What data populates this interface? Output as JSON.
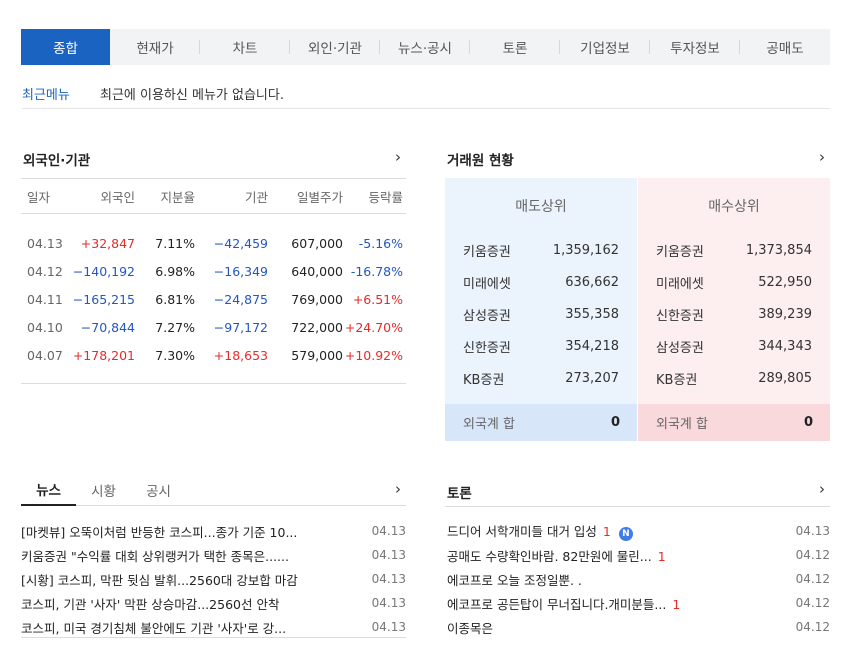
{
  "tabs": [
    "종합",
    "현재가",
    "차트",
    "외인·기관",
    "뉴스·공시",
    "토론",
    "기업정보",
    "투자정보",
    "공매도"
  ],
  "recent": {
    "label": "최근메뉴",
    "message": "최근에 이용하신 메뉴가 없습니다."
  },
  "foreign": {
    "title": "외국인·기관",
    "headers": [
      "일자",
      "외국인",
      "지분율",
      "기관",
      "일별주가",
      "등락률"
    ],
    "rows": [
      {
        "date": "04.13",
        "foreign": "+32,847",
        "share": "7.11%",
        "inst": "−42,459",
        "close": "607,000",
        "rate": "-5.16%"
      },
      {
        "date": "04.12",
        "foreign": "−140,192",
        "share": "6.98%",
        "inst": "−16,349",
        "close": "640,000",
        "rate": "-16.78%"
      },
      {
        "date": "04.11",
        "foreign": "−165,215",
        "share": "6.81%",
        "inst": "−24,875",
        "close": "769,000",
        "rate": "+6.51%"
      },
      {
        "date": "04.10",
        "foreign": "−70,844",
        "share": "7.27%",
        "inst": "−97,172",
        "close": "722,000",
        "rate": "+24.70%"
      },
      {
        "date": "04.07",
        "foreign": "+178,201",
        "share": "7.30%",
        "inst": "+18,653",
        "close": "579,000",
        "rate": "+10.92%"
      }
    ]
  },
  "broker": {
    "title": "거래원 현황",
    "sell": {
      "header": "매도상위",
      "items": [
        {
          "name": "키움증권",
          "value": "1,359,162"
        },
        {
          "name": "미래에셋",
          "value": "636,662"
        },
        {
          "name": "삼성증권",
          "value": "355,358"
        },
        {
          "name": "신한증권",
          "value": "354,218"
        },
        {
          "name": "KB증권",
          "value": "273,207"
        }
      ],
      "sum_label": "외국계 합",
      "sum_value": "0"
    },
    "buy": {
      "header": "매수상위",
      "items": [
        {
          "name": "키움증권",
          "value": "1,373,854"
        },
        {
          "name": "미래에셋",
          "value": "522,950"
        },
        {
          "name": "신한증권",
          "value": "389,239"
        },
        {
          "name": "삼성증권",
          "value": "344,343"
        },
        {
          "name": "KB증권",
          "value": "289,805"
        }
      ],
      "sum_label": "외국계 합",
      "sum_value": "0"
    }
  },
  "news": {
    "tabs": [
      "뉴스",
      "시황",
      "공시"
    ],
    "items": [
      {
        "title": "[마켓뷰] 오뚝이처럼 반등한 코스피...종가 기준 10...",
        "date": "04.13"
      },
      {
        "title": "키움증권 \"수익률 대회 상위랭커가 택한 종목은......",
        "date": "04.13"
      },
      {
        "title": "[시황] 코스피, 막판 뒷심 발휘...2560대 강보합 마감",
        "date": "04.13"
      },
      {
        "title": "코스피, 기관 '사자' 막판 상승마감...2560선 안착",
        "date": "04.13"
      },
      {
        "title": "코스피, 미국 경기침체 불안에도 기관 '사자'로 강...",
        "date": "04.13"
      }
    ]
  },
  "discussion": {
    "title": "토론",
    "items": [
      {
        "title": "드디어 서학개미들 대거 입성",
        "count": "1",
        "badge": "N",
        "date": "04.13"
      },
      {
        "title": "공매도 수량확인바람. 82만원에 물린...",
        "count": "1",
        "badge": "",
        "date": "04.12"
      },
      {
        "title": "에코프로 오늘 조정일뿐. .",
        "count": "",
        "badge": "",
        "date": "04.12"
      },
      {
        "title": "에코프로 공든탑이 무너집니다.개미분들...",
        "count": "1",
        "badge": "",
        "date": "04.12"
      },
      {
        "title": "이종목은",
        "count": "",
        "badge": "",
        "date": "04.12"
      }
    ]
  },
  "icons": {
    "more": "chevron-right-icon",
    "new_badge": "new-badge-icon"
  },
  "colors": {
    "accent": "#1a63c1",
    "up": "#e62b2b",
    "down": "#2356c0",
    "sell_bg": "#ebf3fc",
    "buy_bg": "#fdeef0"
  }
}
